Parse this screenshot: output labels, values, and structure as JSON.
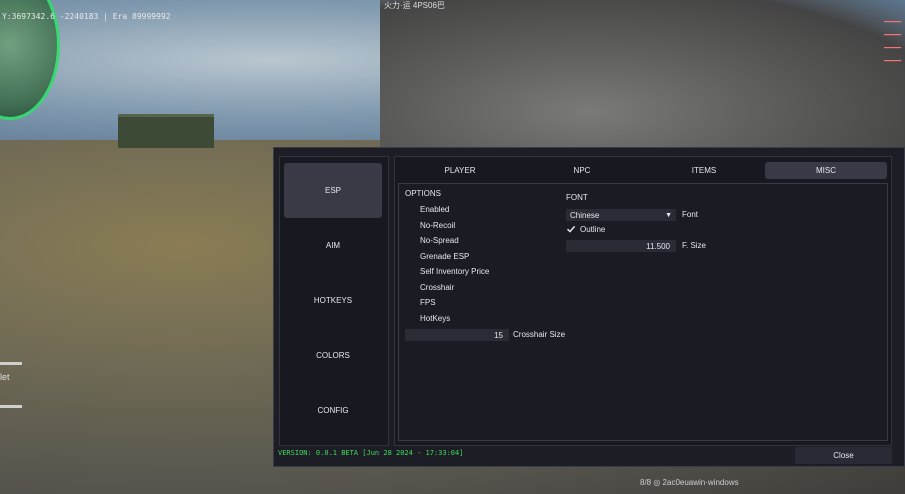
{
  "hud": {
    "top_left": "Y:3697342.6  -2240183 | Era 89999992",
    "top_center": "火力·运 4PS06巴",
    "side_label": "let",
    "bottom_right": "8/8   ◎ 2ac0euawin·windows"
  },
  "sidebar": {
    "items": [
      {
        "label": "ESP",
        "active": true
      },
      {
        "label": "AIM",
        "active": false
      },
      {
        "label": "HOTKEYS",
        "active": false
      },
      {
        "label": "COLORS",
        "active": false
      },
      {
        "label": "CONFIG",
        "active": false
      }
    ]
  },
  "tabs": [
    {
      "label": "PLAYER",
      "active": false
    },
    {
      "label": "NPC",
      "active": false
    },
    {
      "label": "ITEMS",
      "active": false
    },
    {
      "label": "MISC",
      "active": true
    }
  ],
  "options": {
    "title": "OPTIONS",
    "items": [
      "Enabled",
      "No-Recoil",
      "No-Spread",
      "Grenade ESP",
      "Self Inventory Price",
      "Crosshair",
      "FPS",
      "HotKeys"
    ],
    "crosshair_size_value": "15",
    "crosshair_size_label": "Crosshair Size"
  },
  "font": {
    "title": "FONT",
    "selected": "Chinese",
    "select_label": "Font",
    "outline_label": "Outline",
    "outline_checked": true,
    "size_value": "11.500",
    "size_label": "F. Size"
  },
  "footer": {
    "version": "VERSION: 0.0.1 BETA [Jun 28 2024 - 17:33:04]",
    "close_label": "Close"
  },
  "colors": {
    "accent_green": "#3fdc58",
    "panel_bg": "#1d1d26",
    "active_item": "#3a3a47"
  }
}
